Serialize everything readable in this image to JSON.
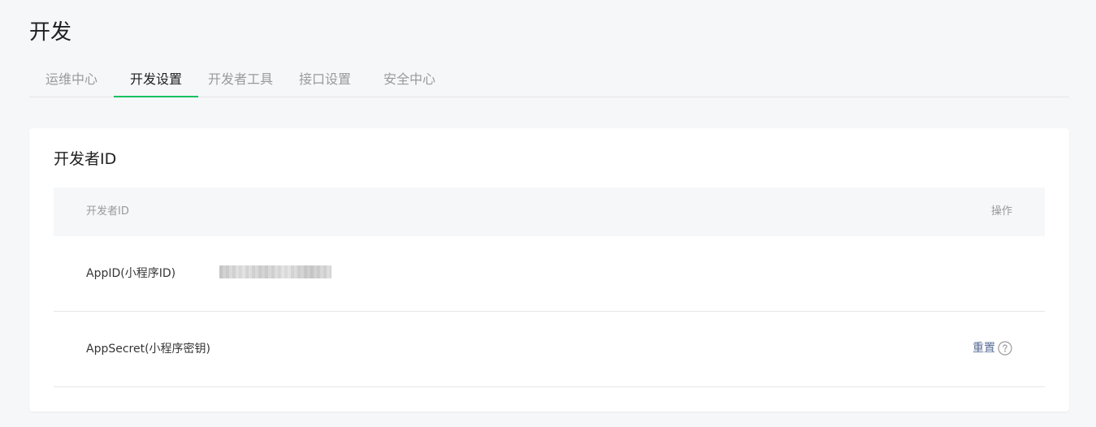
{
  "page": {
    "title": "开发"
  },
  "tabs": [
    {
      "label": "运维中心",
      "active": false
    },
    {
      "label": "开发设置",
      "active": true
    },
    {
      "label": "开发者工具",
      "active": false
    },
    {
      "label": "接口设置",
      "active": false
    },
    {
      "label": "安全中心",
      "active": false
    }
  ],
  "developer_id": {
    "title": "开发者ID",
    "columns": {
      "id": "开发者ID",
      "action": "操作"
    },
    "rows": [
      {
        "label": "AppID(小程序ID)",
        "value": "",
        "value_obscured": true
      },
      {
        "label": "AppSecret(小程序密钥)",
        "action_label": "重置",
        "action_icon": "help-circle-icon"
      }
    ]
  },
  "colors": {
    "accent": "#07c160",
    "link": "#576b95",
    "page_bg": "#f6f7f9"
  }
}
